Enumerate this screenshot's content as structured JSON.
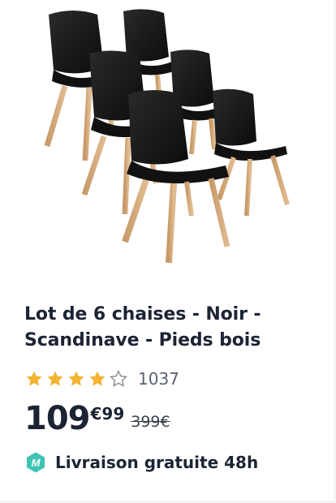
{
  "product": {
    "image_icon": "product-chairs-image",
    "title": "Lot de 6 chaises - Noir - Scandinave - Pieds bois",
    "rating": {
      "stars_filled": 4,
      "stars_total": 5,
      "count": "1037"
    },
    "price": {
      "main": "109",
      "cents": "€99",
      "old": "399€"
    },
    "delivery": {
      "icon": "m-badge-icon",
      "text": "Livraison gratuite 48h"
    }
  },
  "colors": {
    "star": "#f5b332",
    "star_empty": "#8c8c8c",
    "badge": "#3fc4b4",
    "text": "#1c2434"
  }
}
